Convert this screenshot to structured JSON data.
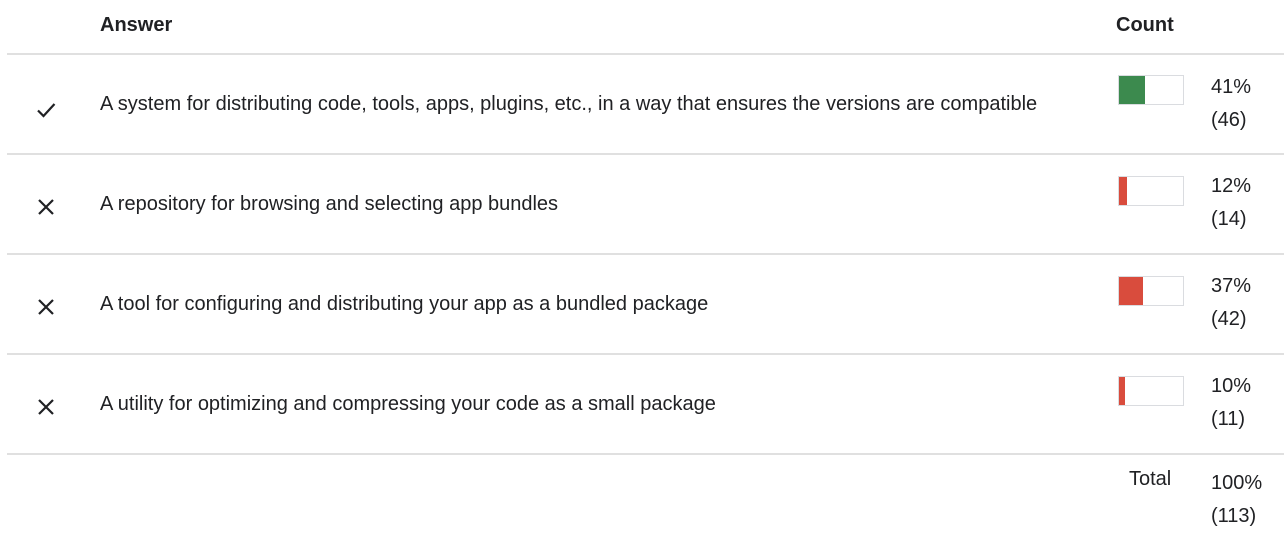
{
  "header": {
    "answer_label": "Answer",
    "count_label": "Count"
  },
  "colors": {
    "correct": "#3c8a4e",
    "incorrect": "#d94c3d",
    "divider": "#e0e0e0"
  },
  "rows": [
    {
      "status": "correct",
      "icon": "check-icon",
      "text": "A system for distributing code, tools, apps, plugins, etc., in a way that ensures the versions are compatible",
      "fraction": 0.41,
      "percent": "41%",
      "count": "(46)"
    },
    {
      "status": "incorrect",
      "icon": "close-icon",
      "text": "A repository for browsing and selecting app bundles",
      "fraction": 0.12,
      "percent": "12%",
      "count": "(14)"
    },
    {
      "status": "incorrect",
      "icon": "close-icon",
      "text": "A tool for configuring and distributing your app as a bundled package",
      "fraction": 0.37,
      "percent": "37%",
      "count": "(42)"
    },
    {
      "status": "incorrect",
      "icon": "close-icon",
      "text": "A utility for optimizing and compressing your code as a small package",
      "fraction": 0.1,
      "percent": "10%",
      "count": "(11)"
    }
  ],
  "total": {
    "label": "Total",
    "percent": "100%",
    "count": "(113)"
  }
}
